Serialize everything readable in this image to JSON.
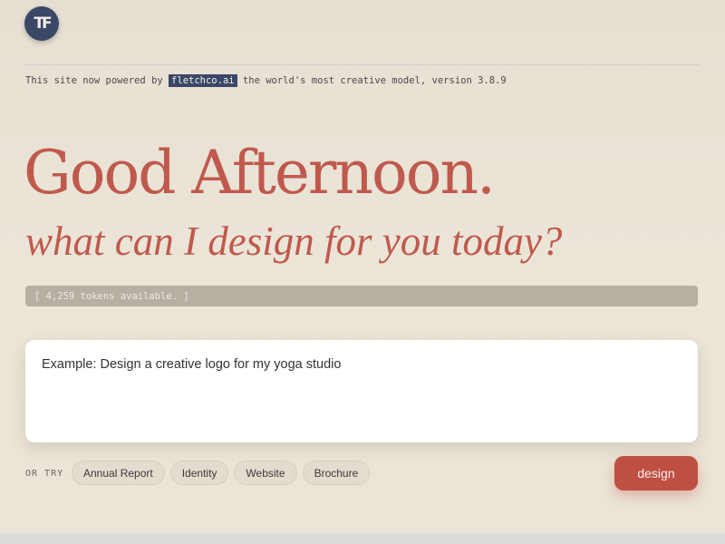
{
  "header": {
    "logo_text": "TF",
    "logo_icon": "tf-monogram-icon"
  },
  "powered_by": {
    "prefix": "This site now powered by",
    "brand": "fletchco.ai",
    "suffix": "the world's most creative model, version 3.8.9"
  },
  "greeting": {
    "headline": "Good Afternoon.",
    "subheadline": "what can I design for you today?"
  },
  "tokens": {
    "text": "[ 4,259 tokens available. ]"
  },
  "prompt": {
    "placeholder": "Example: Design a creative logo for my yoga studio",
    "value": ""
  },
  "suggestions": {
    "label": "OR TRY",
    "chips": [
      "Annual Report",
      "Identity",
      "Website",
      "Brochure"
    ]
  },
  "actions": {
    "design_label": "design"
  },
  "colors": {
    "background": "#e6dfd2",
    "accent": "#c0594d",
    "button": "#bf4f43",
    "brand_navy": "#3a4766",
    "token_bar": "#b6afa2"
  }
}
